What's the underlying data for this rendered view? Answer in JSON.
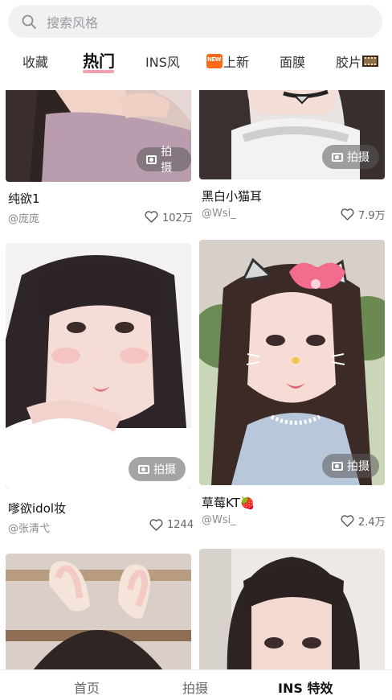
{
  "search": {
    "placeholder": "搜索风格"
  },
  "tabs": [
    {
      "label": "收藏"
    },
    {
      "label": "热门"
    },
    {
      "label": "INS风"
    },
    {
      "label": "上新",
      "badge": "NEW"
    },
    {
      "label": "面膜"
    },
    {
      "label": "胶片"
    }
  ],
  "cards": [
    {
      "title": "纯欲1",
      "author": "@庞庞",
      "likes": "102万",
      "action": "拍摄"
    },
    {
      "title": "黑白小猫耳",
      "author": "@Wsi_",
      "likes": "7.9万",
      "action": "拍摄"
    },
    {
      "title": "嗲欲idol妆",
      "author": "@张清弋",
      "likes": "1244",
      "action": "拍摄"
    },
    {
      "title": "草莓KT🍓",
      "author": "@Wsi_",
      "likes": "2.4万",
      "action": "拍摄"
    }
  ],
  "bottom_nav": [
    {
      "label": "首页"
    },
    {
      "label": "拍摄"
    },
    {
      "label": "INS 特效"
    }
  ],
  "colors": {
    "tab_underline": "#f2a1ad",
    "search_bg": "#f1f1f3",
    "new_badge": "#ff6a1a"
  }
}
